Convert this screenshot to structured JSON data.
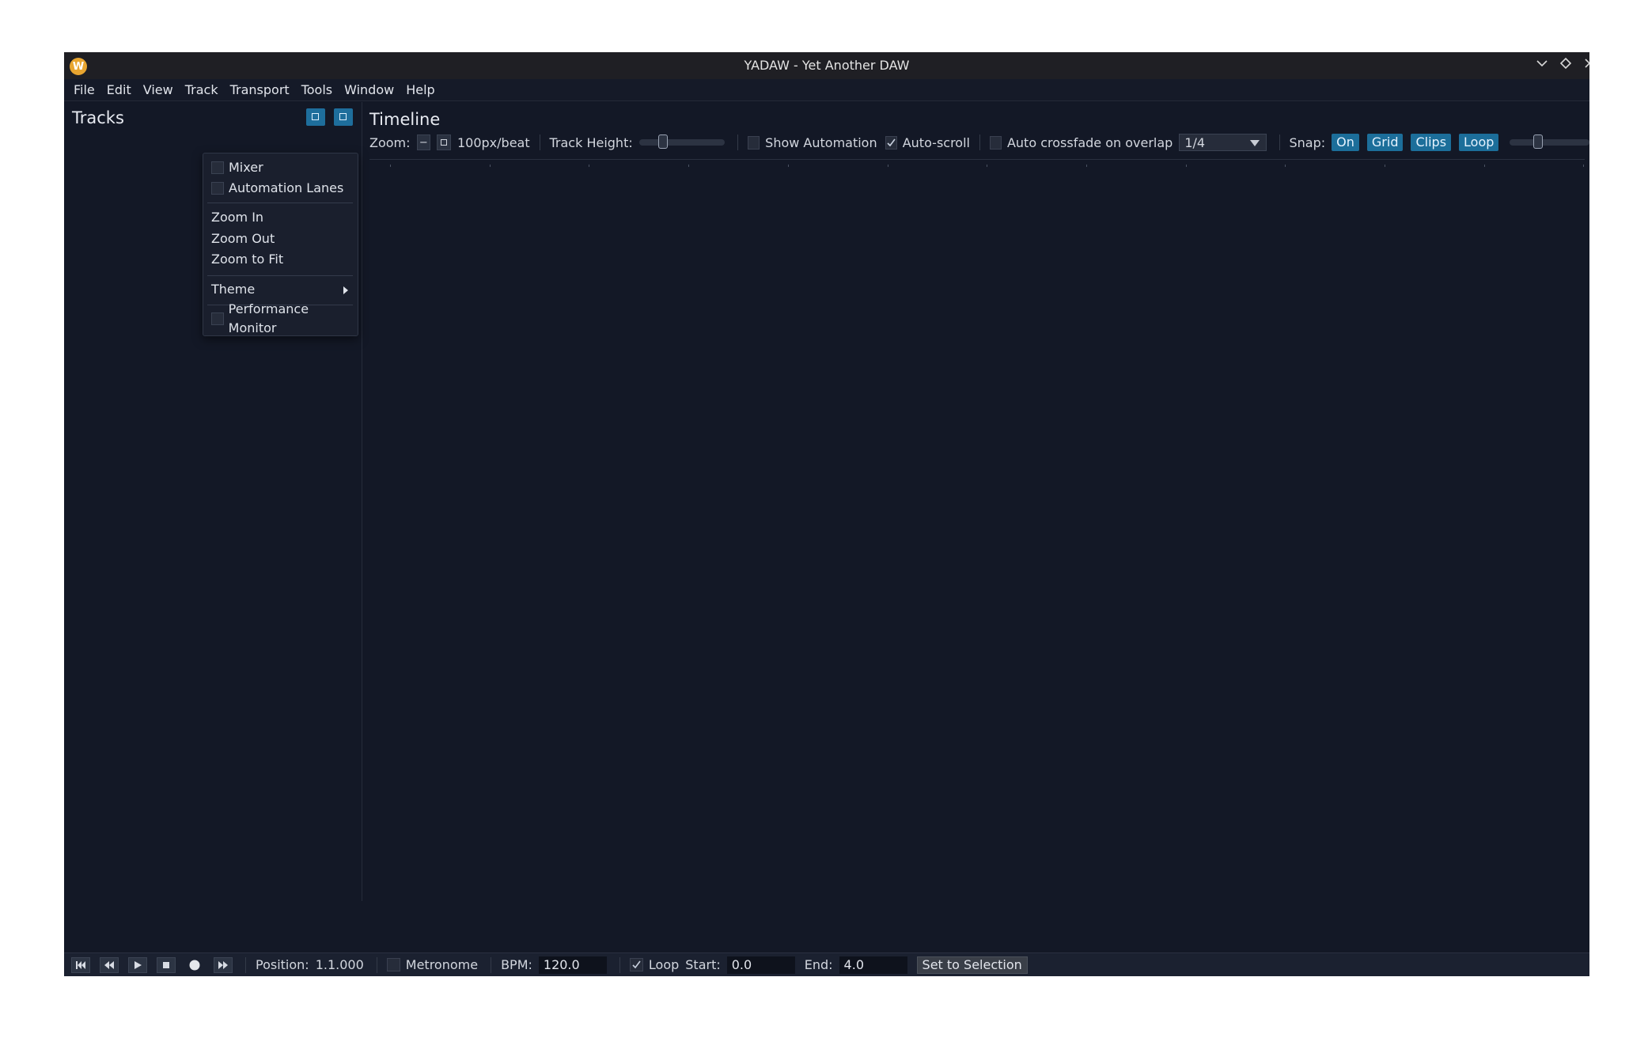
{
  "window": {
    "title": "YADAW - Yet Another DAW",
    "logo_letter": "W"
  },
  "menubar": {
    "items": [
      "File",
      "Edit",
      "View",
      "Track",
      "Transport",
      "Tools",
      "Window",
      "Help"
    ]
  },
  "tracks_panel": {
    "title": "Tracks"
  },
  "view_menu": {
    "mixer": "Mixer",
    "automation_lanes": "Automation Lanes",
    "zoom_in": "Zoom In",
    "zoom_out": "Zoom Out",
    "zoom_to_fit": "Zoom to Fit",
    "theme": "Theme",
    "performance_monitor": "Performance Monitor"
  },
  "timeline": {
    "title": "Timeline",
    "zoom_label": "Zoom:",
    "zoom_value": "100px/beat",
    "zoom_minus": "−",
    "track_height_label": "Track Height:",
    "track_height_level": 0.25,
    "show_automation": "Show Automation",
    "show_automation_checked": false,
    "auto_scroll": "Auto-scroll",
    "auto_scroll_checked": true,
    "auto_crossfade": "Auto crossfade on overlap",
    "auto_crossfade_checked": false,
    "grid_value": "1/4",
    "snap_label": "Snap:",
    "snap_buttons": [
      "On",
      "Grid",
      "Clips",
      "Loop"
    ],
    "zoom_slider_level": 0.33
  },
  "transport": {
    "position_label": "Position:",
    "position_value": "1.1.000",
    "metronome": "Metronome",
    "metronome_checked": false,
    "bpm_label": "BPM:",
    "bpm_value": "120.0",
    "loop": "Loop",
    "loop_checked": true,
    "start_label": "Start:",
    "start_value": "0.0",
    "end_label": "End:",
    "end_value": "4.0",
    "set_to_selection": "Set to Selection"
  },
  "colors": {
    "background": "#131826",
    "accent": "#1e6e9c",
    "titlebar": "#1f1f24",
    "logo": "#e8a530"
  }
}
